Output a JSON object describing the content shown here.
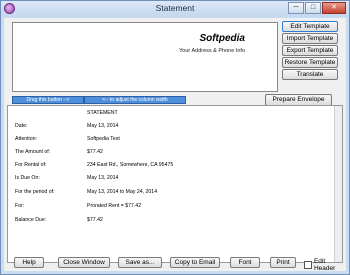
{
  "window": {
    "title": "Statement",
    "controls": {
      "minimize": "─",
      "maximize": "□",
      "close": "✕"
    }
  },
  "preview": {
    "company": "Softpedia",
    "address": "Your Address & Phone Info"
  },
  "side_buttons": {
    "edit_template": "Edit Template",
    "import_template": "Import Template",
    "export_template": "Export Template",
    "restore_template": "Restore Template",
    "translate": "Translate",
    "prepare_envelope": "Prepare Envelope"
  },
  "drag_bar": {
    "left": "Drag this button -->",
    "right": "<-- to adjust the column width"
  },
  "statement": {
    "rows": [
      {
        "label": "",
        "value": "STATEMENT"
      },
      {
        "label": "Date:",
        "value": "May 13, 2014"
      },
      {
        "label": "Attention:",
        "value": "Softpedia Test"
      },
      {
        "label": "The Amount of:",
        "value": "$77.42"
      },
      {
        "label": "For Rental of:",
        "value": "234 East Rd., Somewhere, CA 95475"
      },
      {
        "label": "Is Due On:",
        "value": "May 13, 2014"
      },
      {
        "label": "For the period of:",
        "value": "May 13, 2014 to May 24, 2014"
      },
      {
        "label": "For:",
        "value": "Prorated Rent = $77.42"
      },
      {
        "label": "Balance Due:",
        "value": "$77.42"
      }
    ]
  },
  "bottom_bar": {
    "help": "Help",
    "close_window": "Close Window",
    "save_as": "Save as...",
    "copy_to_email": "Copy to Email",
    "font": "Font",
    "print": "Print",
    "edit_header": "Edit Header",
    "edit_header_checked": false
  }
}
